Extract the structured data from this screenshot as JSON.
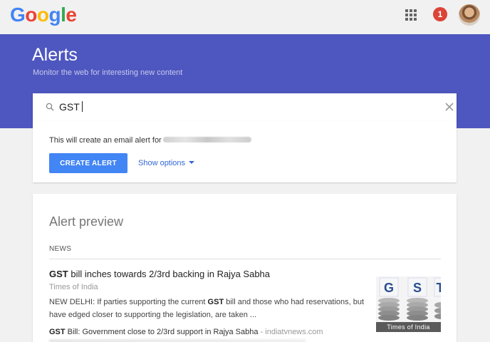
{
  "header": {
    "logo_letters": [
      {
        "ch": "G",
        "color": "#4285f4"
      },
      {
        "ch": "o",
        "color": "#ea4335"
      },
      {
        "ch": "o",
        "color": "#fbbc05"
      },
      {
        "ch": "g",
        "color": "#4285f4"
      },
      {
        "ch": "l",
        "color": "#34a853"
      },
      {
        "ch": "e",
        "color": "#ea4335"
      }
    ],
    "notification_count": "1",
    "apps_icon": "apps-grid-icon",
    "avatar_icon": "user-avatar"
  },
  "banner": {
    "title": "Alerts",
    "subtitle": "Monitor the web for interesting new content",
    "color": "#4e57bf"
  },
  "search": {
    "value": "GST",
    "search_icon": "search-icon",
    "clear_icon": "close-icon"
  },
  "create": {
    "text": "This will create an email alert for",
    "button_label": "CREATE ALERT",
    "show_options_label": "Show options",
    "button_color": "#4285f4"
  },
  "preview": {
    "title": "Alert preview",
    "section_label": "NEWS",
    "article": {
      "title_bold": "GST",
      "title_rest": " bill inches towards 2/3rd backing in Rajya Sabha",
      "source": "Times of India",
      "snippet_a": "NEW DELHI: If parties supporting the current ",
      "snippet_bold": "GST",
      "snippet_b": " bill and those who had reservations, but have edged closer to supporting the legislation, are taken ...",
      "thumb_caption": "Times of India",
      "thumb_letters": [
        "G",
        "S",
        "T"
      ]
    },
    "article2": {
      "title_bold": "GST",
      "title_rest": " Bill: Government close to 2/3rd support in Rajya Sabha",
      "source": " - indiatvnews.com"
    }
  }
}
